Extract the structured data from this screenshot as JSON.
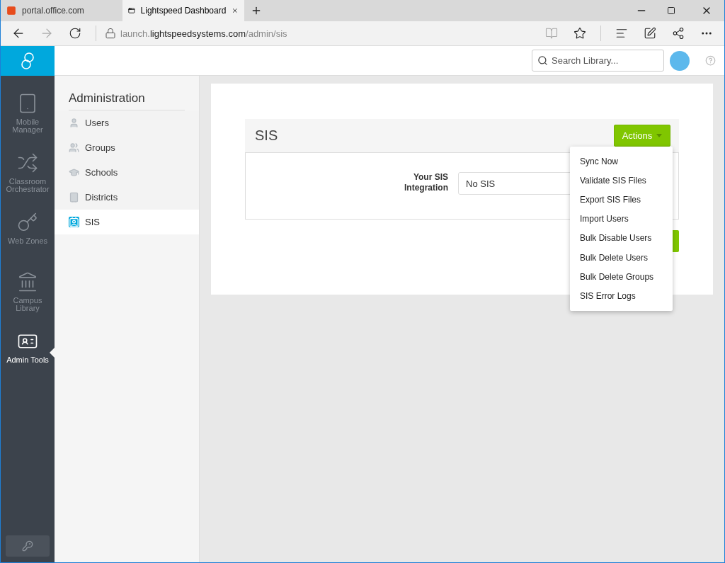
{
  "browser": {
    "tabs": [
      {
        "title": "portal.office.com",
        "selected": false
      },
      {
        "title": "Lightspeed Dashboard",
        "selected": true
      }
    ],
    "url": {
      "prefix": "launch.",
      "domain": "lightspeedsystems.com",
      "path": "/admin/sis"
    }
  },
  "header": {
    "search": {
      "placeholder": "Search Library..."
    }
  },
  "nav": [
    {
      "label": "Mobile Manager",
      "kind": "tablet",
      "selected": false
    },
    {
      "label": "Classroom Orchestrator",
      "kind": "arrows",
      "selected": false
    },
    {
      "label": "Web Zones",
      "kind": "key",
      "selected": false
    },
    {
      "label": "Campus Library",
      "kind": "library",
      "selected": false
    },
    {
      "label": "Admin Tools",
      "kind": "idcard",
      "selected": true
    }
  ],
  "sidebar": {
    "title": "Administration",
    "items": [
      {
        "label": "Users",
        "kind": "user",
        "selected": false
      },
      {
        "label": "Groups",
        "kind": "group",
        "selected": false
      },
      {
        "label": "Schools",
        "kind": "school",
        "selected": false
      },
      {
        "label": "Districts",
        "kind": "district",
        "selected": false
      },
      {
        "label": "SIS",
        "kind": "sis",
        "selected": true
      }
    ]
  },
  "panel": {
    "title": "SIS",
    "actions_button": "Actions",
    "field_label": "Your SIS Integration",
    "field_value": "No SIS",
    "menu": [
      "Sync Now",
      "Validate SIS Files",
      "Export SIS Files",
      "Import Users",
      "Bulk Disable Users",
      "Bulk Delete Users",
      "Bulk Delete Groups",
      "SIS Error Logs"
    ]
  }
}
